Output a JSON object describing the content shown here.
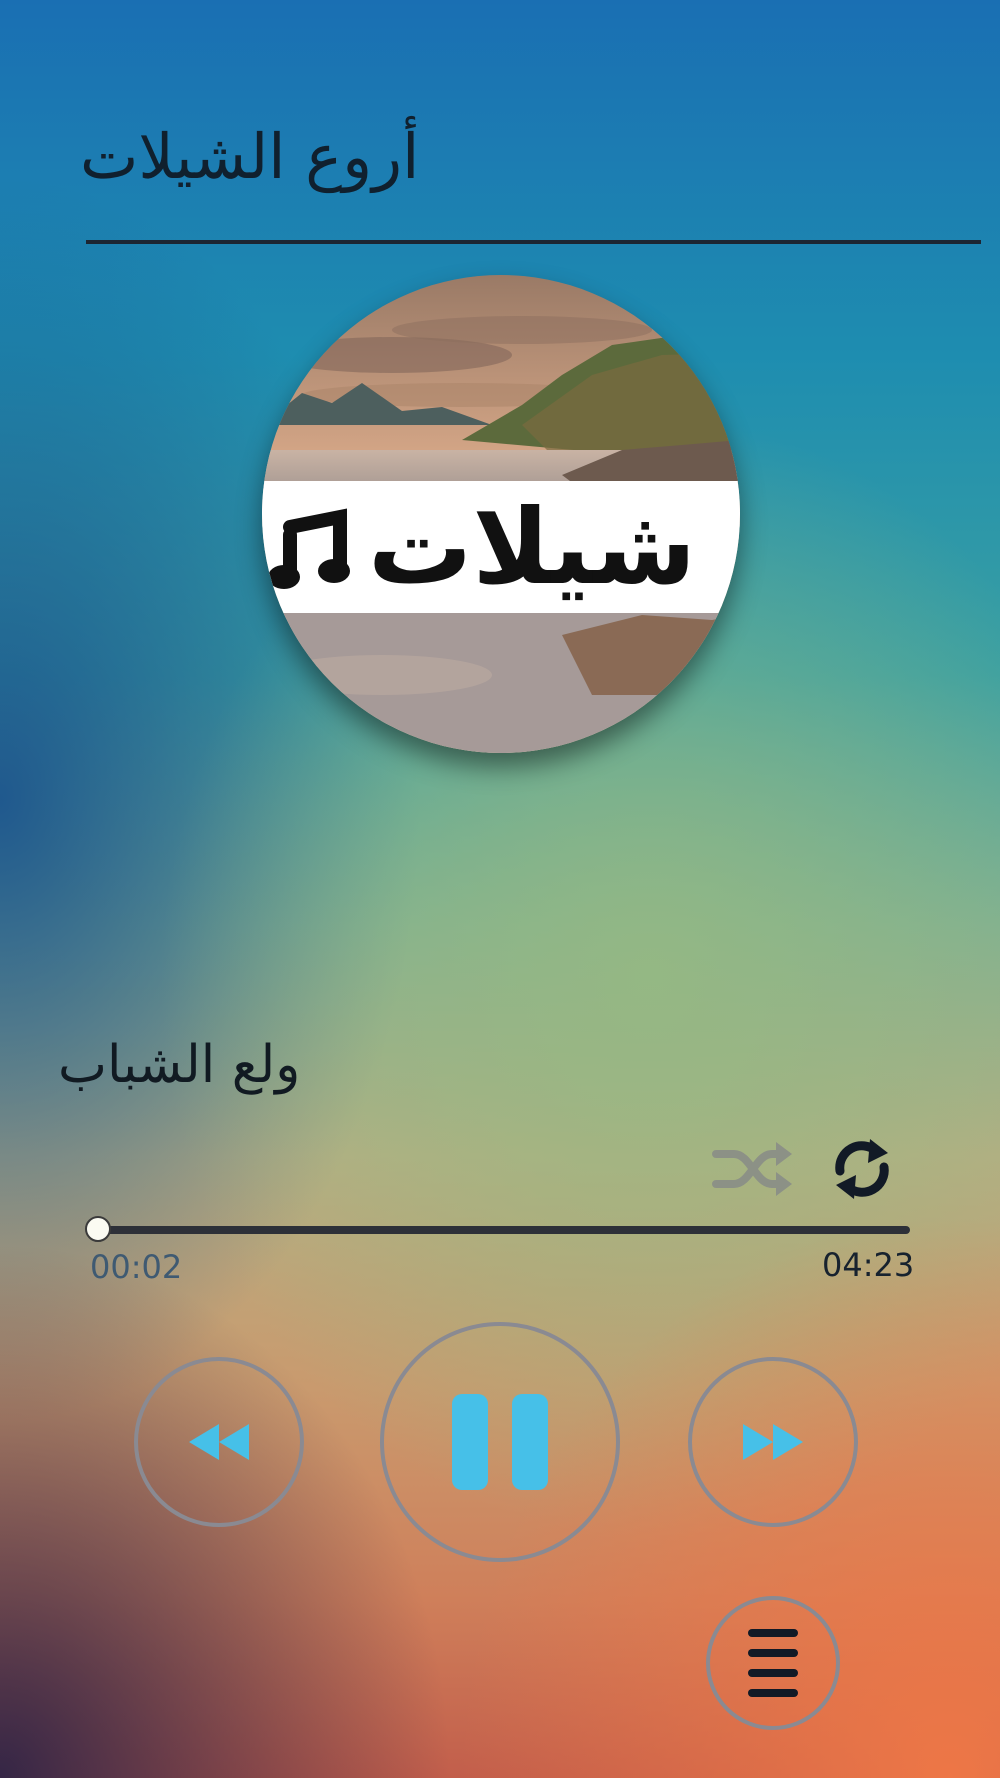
{
  "header": {
    "title": "أروع الشيلات"
  },
  "album_art": {
    "label": "شيلات",
    "icon": "music-note-icon"
  },
  "player": {
    "track_title": "ولع الشباب",
    "elapsed": "00:02",
    "duration": "04:23",
    "progress_fraction": 0.0076,
    "shuffle_enabled": false,
    "repeat_enabled": true,
    "state": "playing"
  },
  "controls": {
    "rewind_icon": "rewind-icon",
    "pause_icon": "pause-icon",
    "forward_icon": "fast-forward-icon",
    "playlist_icon": "menu-icon",
    "shuffle_icon": "shuffle-icon",
    "repeat_icon": "repeat-icon"
  },
  "colors": {
    "accent": "#46c0e8",
    "text_dark": "#10202e",
    "ring": "#8a8a92"
  }
}
